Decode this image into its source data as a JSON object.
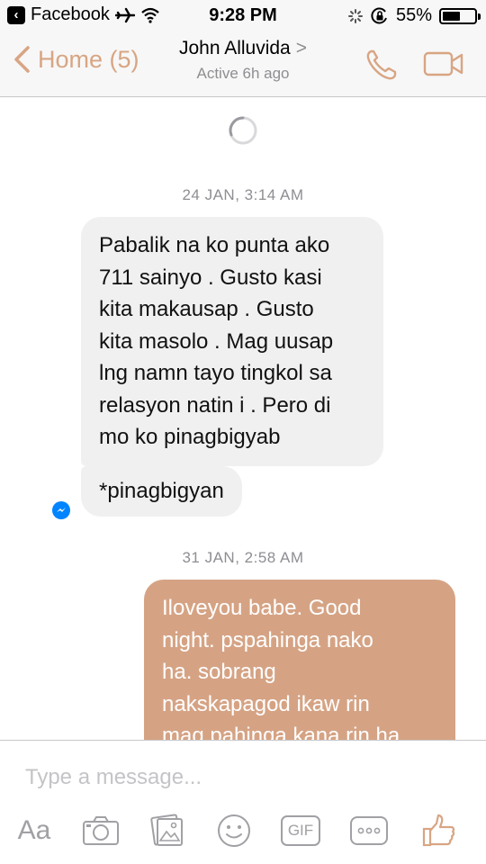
{
  "status_bar": {
    "back_app": "Facebook",
    "time": "9:28 PM",
    "battery": "55%",
    "battery_level": 0.55
  },
  "header": {
    "back_label": "Home (5)",
    "contact_name": "John Alluvida",
    "title_chevron": ">",
    "active_status": "Active 6h ago"
  },
  "conversation": {
    "groups": [
      {
        "date": "24 JAN, 3:14 AM",
        "messages": [
          {
            "direction": "incoming",
            "lines": [
              "Pabalik na ko punta ako",
              "711 sainyo . Gusto kasi",
              "kita makausap . Gusto",
              "kita masolo . Mag uusap",
              "lng namn tayo tingkol sa",
              "relasyon natin i . Pero di",
              "mo ko pinagbigyab"
            ]
          },
          {
            "direction": "incoming",
            "lines": [
              "*pinagbigyan"
            ]
          }
        ]
      },
      {
        "date": "31 JAN, 2:58 AM",
        "messages": [
          {
            "direction": "outgoing",
            "lines": [
              "Iloveyou babe. Good",
              "night. pspahinga nako",
              "ha. sobrang",
              "nakskapagod ikaw rin",
              "mag pahinga kana rin ha."
            ]
          }
        ]
      }
    ]
  },
  "composer": {
    "placeholder": "Type a message...",
    "text_style_label": "Aa",
    "gif_label": "GIF"
  },
  "colors": {
    "accent": "#d8a583",
    "outgoing_bubble": "#d5a384",
    "incoming_bubble": "#f1f0f0",
    "seen_badge": "#0084ff",
    "icon_gray": "#a0a0a5"
  },
  "icons": {
    "back_app": "back-to-app-icon",
    "airplane": "airplane-mode-icon",
    "wifi": "wifi-icon",
    "orientation_lock": "orientation-lock-icon",
    "battery": "battery-icon",
    "call": "phone-icon",
    "video": "video-camera-icon",
    "camera": "camera-icon",
    "gallery": "photo-gallery-icon",
    "emoji": "emoji-icon",
    "more": "more-icon",
    "like": "thumbs-up-icon"
  }
}
